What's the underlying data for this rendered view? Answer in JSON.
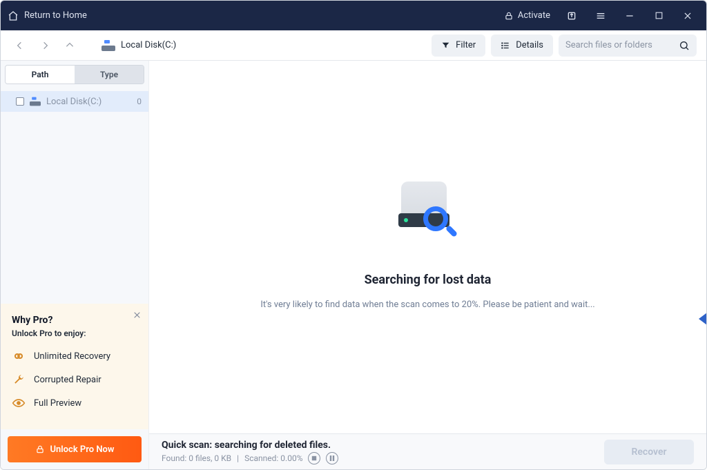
{
  "titlebar": {
    "return_home": "Return to Home",
    "activate": "Activate"
  },
  "toolbar": {
    "location_label": "Local Disk(C:)",
    "filter_label": "Filter",
    "details_label": "Details",
    "search_placeholder": "Search files or folders"
  },
  "sidebar": {
    "tabs": {
      "path": "Path",
      "type": "Type"
    },
    "tree": {
      "root": {
        "label": "Local Disk(C:)",
        "count": "0"
      }
    }
  },
  "pro": {
    "title": "Why Pro?",
    "subtitle": "Unlock Pro to enjoy:",
    "features": {
      "recovery": "Unlimited Recovery",
      "repair": "Corrupted Repair",
      "preview": "Full Preview"
    },
    "cta": "Unlock Pro Now"
  },
  "main": {
    "heading": "Searching for lost data",
    "subtext": "It's very likely to find data when the scan comes to 20%. Please be patient and wait..."
  },
  "status": {
    "title": "Quick scan: searching for deleted files.",
    "found": "Found: 0 files, 0 KB",
    "sep": "|",
    "scanned": "Scanned: 0.00%",
    "recover": "Recover"
  }
}
